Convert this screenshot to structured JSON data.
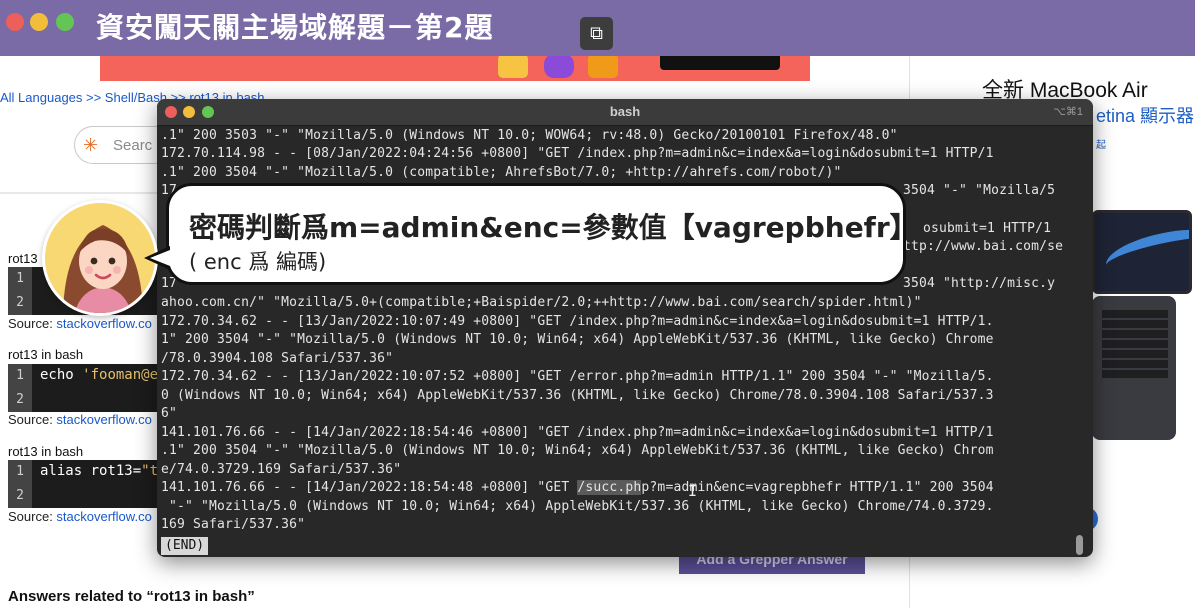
{
  "video_overlay": {
    "title": "資安闖天關主場域解題－第2題",
    "pip_icon": "picture-in-picture-exit-icon"
  },
  "background_page": {
    "breadcrumb": "All Languages >> Shell/Bash >> rot13 in bash",
    "search_placeholder": "Searc",
    "snippets": [
      {
        "title": "rot13",
        "line_numbers": [
          "1",
          "2"
        ],
        "code": ""
      },
      {
        "title": "rot13 in bash",
        "line_numbers": [
          "1",
          "2"
        ],
        "code_keyword": "echo ",
        "code_string": "'fooman@e"
      },
      {
        "title": "rot13 in bash",
        "line_numbers": [
          "1",
          "2"
        ],
        "code_keyword": "alias rot13=",
        "code_string": "\"t"
      }
    ],
    "source_label": "Source: ",
    "source_link": "stackoverflow.co",
    "answers_heading": "Answers related to “rot13 in bash”",
    "grepper_button": "Add a Grepper Answer",
    "mac_ad": {
      "title": "全新 MacBook Air",
      "subtitle": "etina 顯示器",
      "link": "起"
    }
  },
  "terminal": {
    "title": "bash",
    "shortcut": "⌥⌘1",
    "lines": [
      ".1\" 200 3503 \"-\" \"Mozilla/5.0 (Windows NT 10.0; WOW64; rv:48.0) Gecko/20100101 Firefox/48.0\"",
      "172.70.114.98 - - [08/Jan/2022:04:24:56 +0800] \"GET /index.php?m=admin&c=index&a=login&dosubmit=1 HTTP/1",
      ".1\" 200 3504 \"-\" \"Mozilla/5.0 (compatible; AhrefsBot/7.0; +http://ahrefs.com/robot/)\"",
      "172.70.34.62 - - [13/Jan/2022:10:07:49 +0800] \"GET /index.php?m=admin&c=index&a=login&dosubmit=1 HTTP/1.",
      "1\" 200 3504 \"-\" \"Mozilla/5.0 (Windows NT 10.0; Win64; x64) AppleWebKit/537.36 (KHTML, like Gecko) Chrome",
      "/78.0.3904.108 Safari/537.36\"",
      "172.70.34.62 - - [13/Jan/2022:10:07:52 +0800] \"GET /error.php?m=admin HTTP/1.1\" 200 3504 \"-\" \"Mozilla/5.",
      "0 (Windows NT 10.0; Win64; x64) AppleWebKit/537.36 (KHTML, like Gecko) Chrome/78.0.3904.108 Safari/537.3",
      "6\"",
      "141.101.76.66 - - [14/Jan/2022:18:54:46 +0800] \"GET /index.php?m=admin&c=index&a=login&dosubmit=1 HTTP/1",
      ".1\" 200 3504 \"-\" \"Mozilla/5.0 (Windows NT 10.0; Win64; x64) AppleWebKit/537.36 (KHTML, like Gecko) Chrom",
      "e/74.0.3729.169 Safari/537.36\"",
      " \"-\" \"Mozilla/5.0 (Windows NT 10.0; Win64; x64) AppleWebKit/537.36 (KHTML, like Gecko) Chrome/74.0.3729.",
      "169 Safari/537.36\""
    ],
    "partial_lines": [
      "17",
      "3504 \"-\" \"Mozilla/5",
      "osubmit=1 HTTP/1",
      "ttp://www.bai.com/se",
      "17",
      "3504 \"http://misc.y",
      "ahoo.com.cn/\" \"Mozilla/5.0+(compatible;+Baispider/2.0;++http://www.bai.com/search/spider.html)\""
    ],
    "highlight_line": {
      "before": "141.101.76.66 - - [14/Jan/2022:18:54:48 +0800] \"GET ",
      "selected": "/succ.ph",
      "after": "p?m=admin&enc=vagrepbhefr HTTP/1.1\" 200 3504"
    },
    "end_marker": "(END)"
  },
  "bubble": {
    "main": "密碼判斷爲m=admin&enc=參數值【vagrepbhefr】",
    "sub": "( enc 爲 編碼)"
  },
  "colors": {
    "title_bar": "#7a6aa6",
    "terminal_bg": "#282828",
    "link_blue": "#1a58c9"
  }
}
